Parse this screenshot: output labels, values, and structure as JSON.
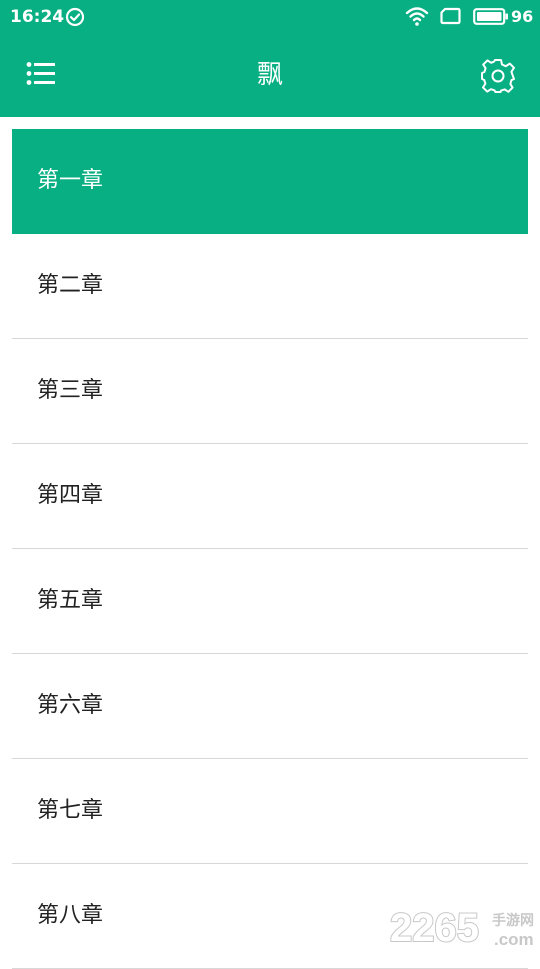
{
  "status_bar": {
    "time": "16:24",
    "battery": "96"
  },
  "header": {
    "title": "飘"
  },
  "chapters": [
    {
      "label": "第一章",
      "selected": true
    },
    {
      "label": "第二章",
      "selected": false
    },
    {
      "label": "第三章",
      "selected": false
    },
    {
      "label": "第四章",
      "selected": false
    },
    {
      "label": "第五章",
      "selected": false
    },
    {
      "label": "第六章",
      "selected": false
    },
    {
      "label": "第七章",
      "selected": false
    },
    {
      "label": "第八章",
      "selected": false
    }
  ],
  "watermark": {
    "number": "2265",
    "suffix": "手游网",
    "domain": ".com"
  },
  "colors": {
    "accent": "#07af82",
    "text": "#222222",
    "divider": "#d8d8d8"
  },
  "icons": {
    "status": [
      "check-circle-icon",
      "wifi-icon",
      "sim-icon",
      "battery-icon"
    ],
    "header": [
      "list-menu-icon",
      "gear-icon"
    ]
  }
}
